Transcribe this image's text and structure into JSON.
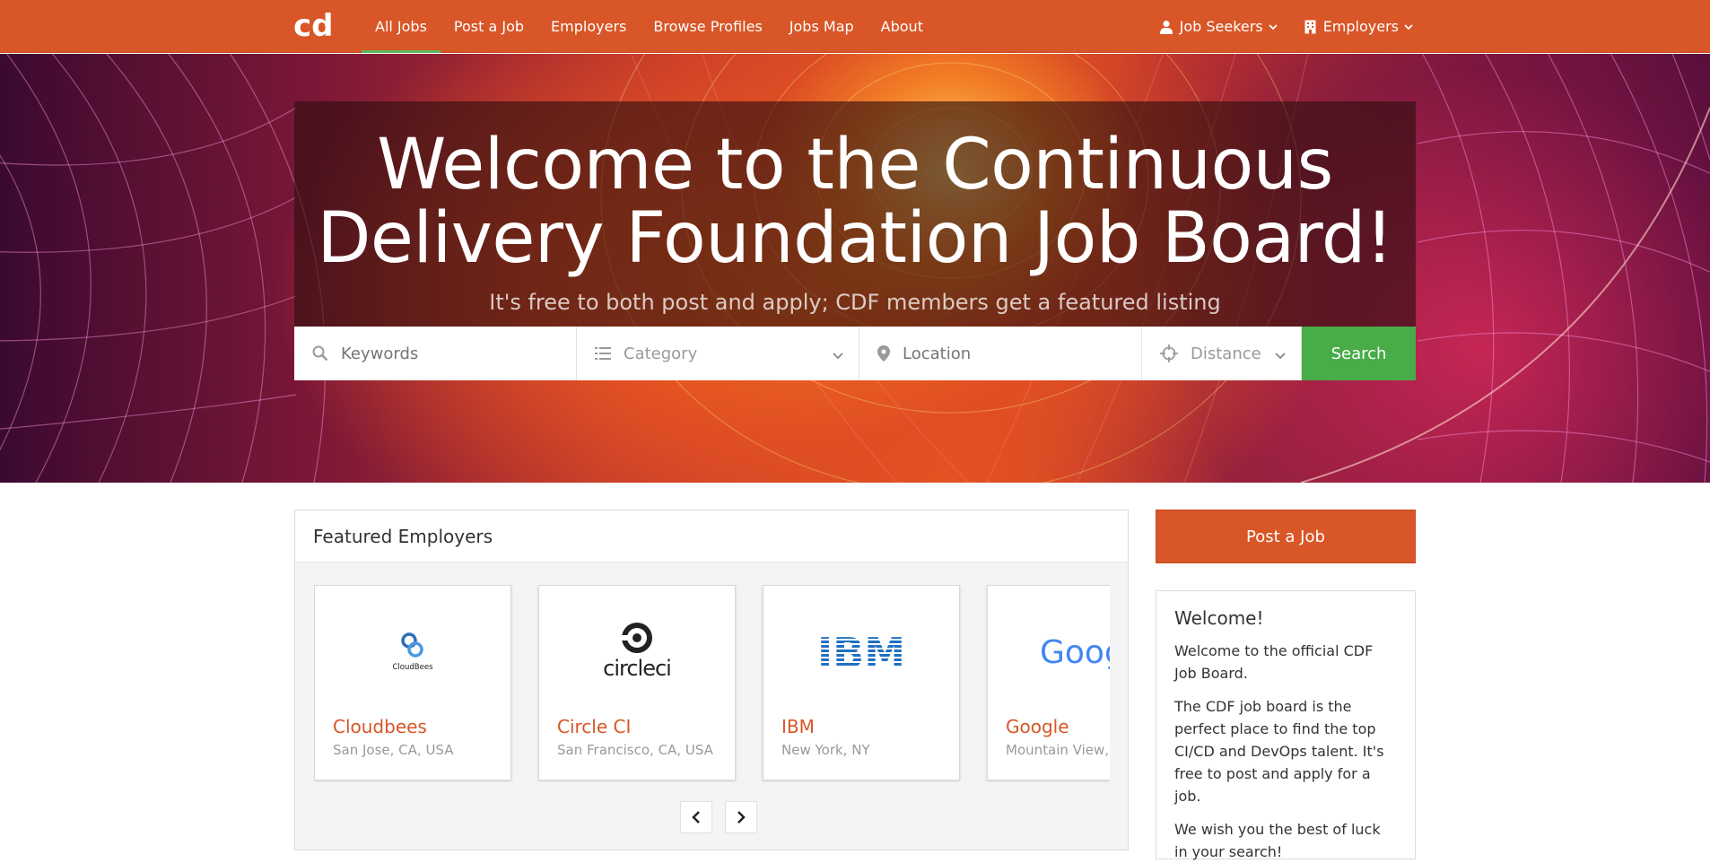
{
  "nav": {
    "logo_text": "cd",
    "items": [
      {
        "label": "All Jobs",
        "active": true
      },
      {
        "label": "Post a Job"
      },
      {
        "label": "Employers"
      },
      {
        "label": "Browse Profiles"
      },
      {
        "label": "Jobs Map"
      },
      {
        "label": "About"
      }
    ],
    "right": {
      "job_seekers": "Job Seekers",
      "employers": "Employers"
    }
  },
  "hero": {
    "title": "Welcome to the Continuous Delivery Foundation Job Board!",
    "subtitle": "It's free to both post and apply; CDF members get a featured listing"
  },
  "search": {
    "keywords_placeholder": "Keywords",
    "category_placeholder": "Category",
    "location_placeholder": "Location",
    "distance_placeholder": "Distance",
    "button": "Search"
  },
  "featured": {
    "title": "Featured Employers",
    "employers": [
      {
        "name": "Cloudbees",
        "location": "San Jose, CA, USA",
        "logo_text": "CloudBees"
      },
      {
        "name": "Circle CI",
        "location": "San Francisco, CA, USA",
        "logo_text": "circleci"
      },
      {
        "name": "IBM",
        "location": "New York, NY",
        "logo_text": "IBM"
      },
      {
        "name": "Google",
        "location": "Mountain View,",
        "logo_text": "Goog"
      }
    ]
  },
  "sidebar": {
    "post_button": "Post a Job",
    "welcome_title": "Welcome!",
    "p1": "Welcome to the official CDF Job Board.",
    "p2": "The CDF job board is the perfect place to find the top CI/CD and DevOps talent. It's free to post and apply for a job.",
    "p3": "We wish you the best of luck in your search!"
  },
  "colors": {
    "brand": "#d85627",
    "search": "#48ac48",
    "active_underline": "#5cb85c"
  }
}
